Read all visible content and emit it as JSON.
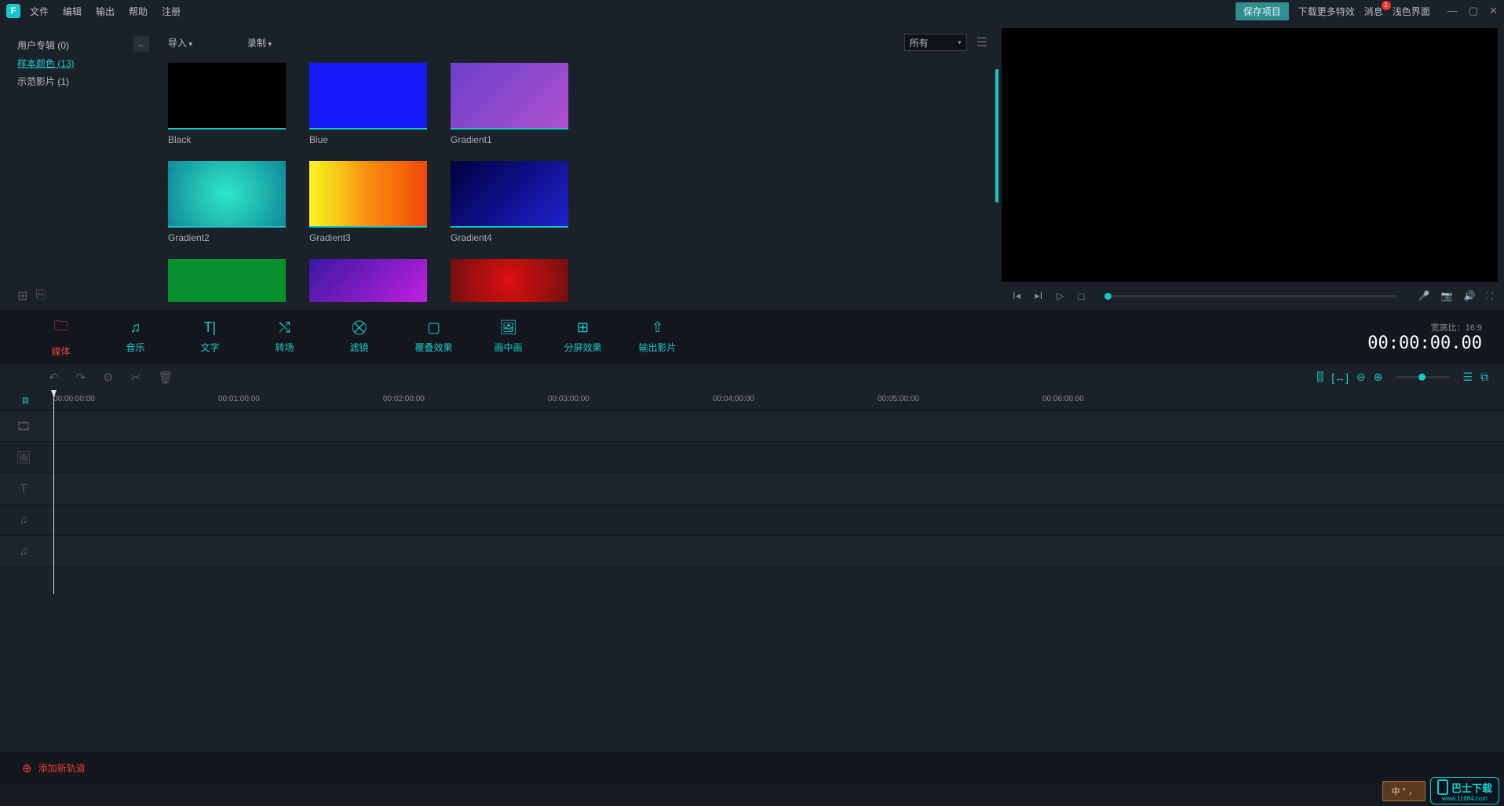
{
  "titlebar": {
    "logo": "F",
    "menu": [
      "文件",
      "编辑",
      "输出",
      "帮助",
      "注册"
    ],
    "save": "保存项目",
    "download_fx": "下载更多特效",
    "messages": "消息",
    "messages_badge": "1",
    "light_ui": "浅色界面"
  },
  "sidebar": {
    "items": [
      {
        "label": "用户专辑 (0)"
      },
      {
        "label": "样本颜色 (13)"
      },
      {
        "label": "示范影片 (1)"
      }
    ]
  },
  "media": {
    "import": "导入",
    "record": "录制",
    "filter": "所有",
    "thumbs": [
      {
        "label": "Black"
      },
      {
        "label": "Blue"
      },
      {
        "label": "Gradient1"
      },
      {
        "label": "Gradient2"
      },
      {
        "label": "Gradient3"
      },
      {
        "label": "Gradient4"
      },
      {
        "label": ""
      },
      {
        "label": ""
      },
      {
        "label": ""
      }
    ]
  },
  "tabs": {
    "items": [
      {
        "label": "媒体",
        "icon": "folder"
      },
      {
        "label": "音乐",
        "icon": "music"
      },
      {
        "label": "文字",
        "icon": "text"
      },
      {
        "label": "转场",
        "icon": "transition"
      },
      {
        "label": "滤镜",
        "icon": "filter"
      },
      {
        "label": "覆叠效果",
        "icon": "overlay"
      },
      {
        "label": "画中画",
        "icon": "pip"
      },
      {
        "label": "分屏效果",
        "icon": "split"
      },
      {
        "label": "输出影片",
        "icon": "export"
      }
    ],
    "aspect": "宽高比：16:9",
    "timecode": "00:00:00.00"
  },
  "timeline": {
    "ruler": [
      "00:00:00:00",
      "00:01:00:00",
      "00:02:00:00",
      "00:03:00:00",
      "00:04:00:00",
      "00:05:00:00",
      "00:06:00:00"
    ],
    "add_track": "添加新轨道"
  },
  "watermark": {
    "box": "中 ° ，",
    "brand": "巴士下载",
    "url": "www.11684.com"
  }
}
